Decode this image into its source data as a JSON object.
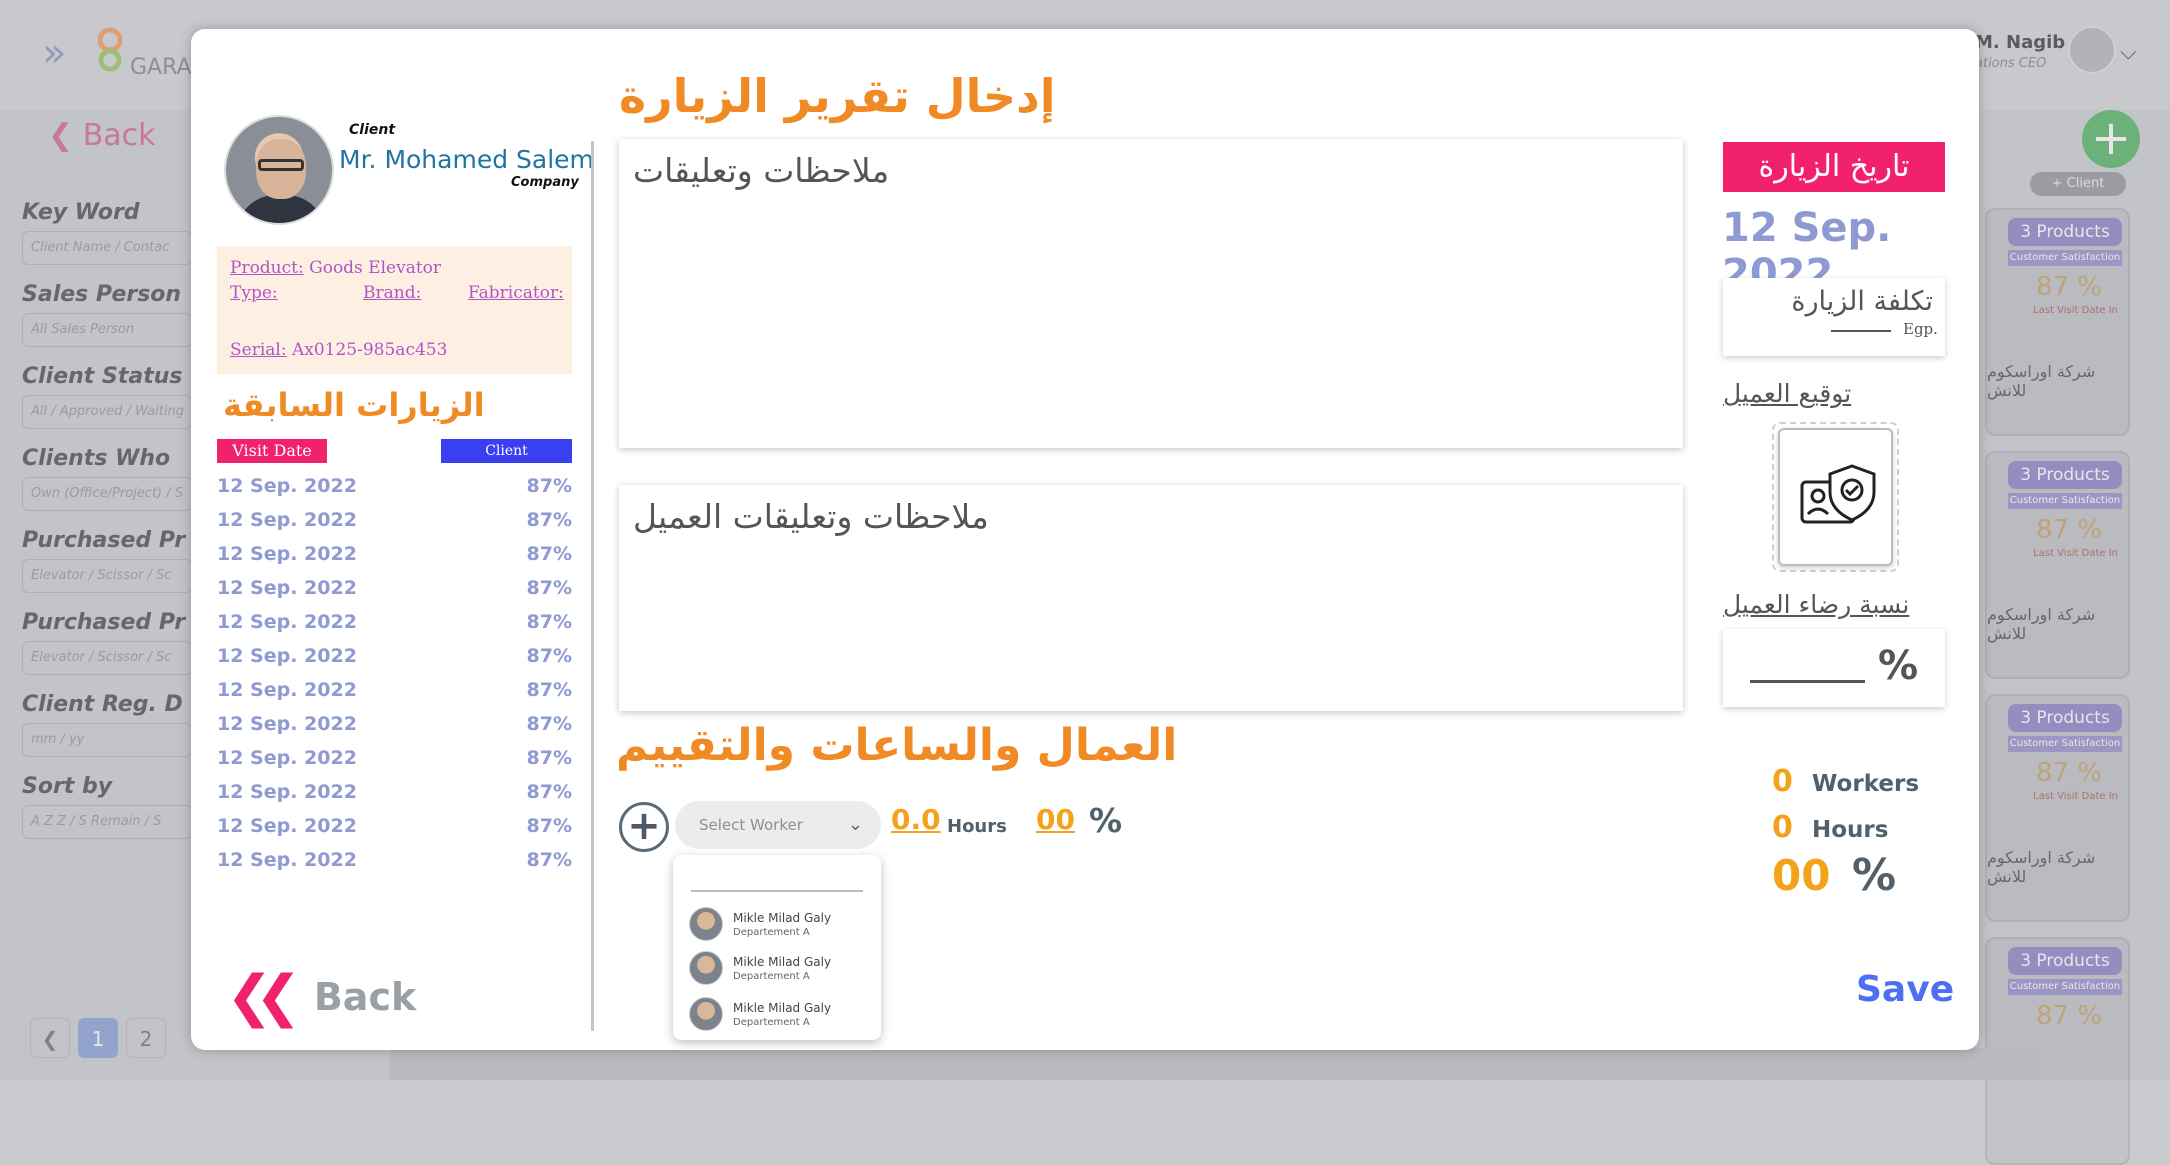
{
  "background": {
    "brand": "GARAS",
    "user_name": "M. Nagib",
    "user_role": "ations CEO",
    "back_label": "Back",
    "filters": [
      {
        "title": "Key Word",
        "placeholder": "Client Name / Contac"
      },
      {
        "title": "Sales Person",
        "placeholder": "All Sales Person"
      },
      {
        "title": "Client Status",
        "placeholder": "All / Approved / Waiting"
      },
      {
        "title": "Clients Who",
        "placeholder": "Own (Office/Project) / S"
      },
      {
        "title": "Purchased Pr",
        "placeholder": "Elevator / Scissor / Sc"
      },
      {
        "title": "Purchased Pr",
        "placeholder": "Elevator / Scissor / Sc"
      },
      {
        "title": "Client Reg. D",
        "placeholder": "mm / yy"
      },
      {
        "title": "Sort by",
        "placeholder": "A Z Z / S Remain / S"
      }
    ],
    "add_client": "+ Client",
    "card": {
      "products": "3 Products",
      "satisfaction_label": "Customer Satisfaction",
      "percent": "87 %",
      "last_visit": "Last Visit Date In",
      "company_ar": "شركة اوراسكوم للانش"
    },
    "pager": [
      "1",
      "2"
    ]
  },
  "modal": {
    "title": "إدخال تقرير الزيارة",
    "client_label": "Client",
    "client_name": "Mr. Mohamed Salem",
    "company_label": "Company",
    "product": {
      "product_label": "Product:",
      "product_value": "Goods Elevator",
      "type_label": "Type:",
      "brand_label": "Brand:",
      "fabricator_label": "Fabricator:",
      "serial_label": "Serial:",
      "serial_value": "Ax0125-985ac453"
    },
    "previous_visits_title": "الزيارات السابقة",
    "visits_header": {
      "date": "Visit Date",
      "satisfaction": "Client Satisfaction"
    },
    "visits": [
      {
        "date": "12 Sep. 2022",
        "satisfaction": "87%"
      },
      {
        "date": "12 Sep. 2022",
        "satisfaction": "87%"
      },
      {
        "date": "12 Sep. 2022",
        "satisfaction": "87%"
      },
      {
        "date": "12 Sep. 2022",
        "satisfaction": "87%"
      },
      {
        "date": "12 Sep. 2022",
        "satisfaction": "87%"
      },
      {
        "date": "12 Sep. 2022",
        "satisfaction": "87%"
      },
      {
        "date": "12 Sep. 2022",
        "satisfaction": "87%"
      },
      {
        "date": "12 Sep. 2022",
        "satisfaction": "87%"
      },
      {
        "date": "12 Sep. 2022",
        "satisfaction": "87%"
      },
      {
        "date": "12 Sep. 2022",
        "satisfaction": "87%"
      },
      {
        "date": "12 Sep. 2022",
        "satisfaction": "87%"
      },
      {
        "date": "12 Sep. 2022",
        "satisfaction": "87%"
      }
    ],
    "back_label": "Back",
    "notes_placeholder": "ملاحظات وتعليقات",
    "client_notes_placeholder": "ملاحظات وتعليقات العميل",
    "workers_title": "العمال والساعات والتقييم",
    "select_worker_placeholder": "Select Worker",
    "hours_value": "0.0",
    "hours_label": "Hours",
    "percent_value": "00",
    "percent_sign": "%",
    "worker_options": [
      {
        "name": "Mikle Milad Galy",
        "department": "Departement A"
      },
      {
        "name": "Mikle Milad Galy",
        "department": "Departement A"
      },
      {
        "name": "Mikle Milad Galy",
        "department": "Departement A"
      }
    ],
    "visit_date_label": "تاريخ الزيارة",
    "visit_date_value": "12 Sep. 2022",
    "cost_label": "تكلفة الزيارة",
    "currency": "Egp.",
    "signature_label": "توقيع العميل",
    "satisfaction_label": "نسبة رضاء العميل",
    "satisfaction_sign": "%",
    "summary": {
      "workers_value": "0",
      "workers_label": "Workers",
      "hours_value": "0",
      "hours_label": "Hours",
      "percent_value": "00",
      "percent_label": "%"
    },
    "save_label": "Save"
  },
  "colors": {
    "accent_orange": "#f08a24",
    "pink": "#f2216e",
    "blue_header": "#3a3ff2",
    "visit_text": "#8f99d2",
    "save": "#4e6ff2"
  }
}
